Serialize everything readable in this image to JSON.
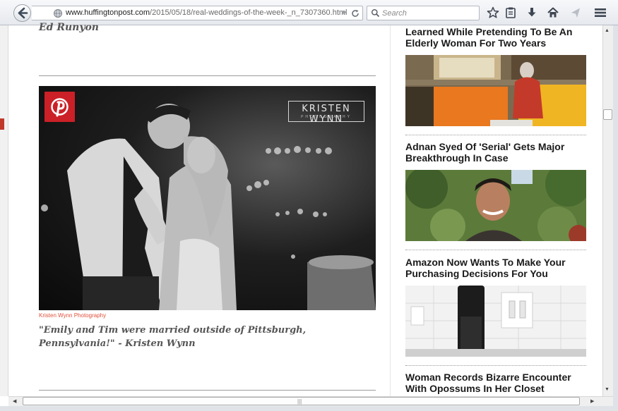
{
  "browser": {
    "url_domain": "www.huffingtonpost.com",
    "url_path": "/2015/05/18/real-weddings-of-the-week-_n_7307360.html",
    "search_placeholder": "Search"
  },
  "article": {
    "author_top": "Ed Runyon",
    "photo_watermark_name": "KRISTEN WYNN",
    "photo_watermark_sub": "PHOTOGRAPHY",
    "photo_credit": "Kristen Wynn Photography",
    "caption": "\"Emily and Tim were married outside of Pittsburgh, Pennsylvania!\" - Kristen Wynn"
  },
  "sidebar": {
    "items": [
      {
        "title": "Learned While Pretending To Be An Elderly Woman For Two Years"
      },
      {
        "title": "Adnan Syed Of 'Serial' Gets Major Breakthrough In Case"
      },
      {
        "title": "Amazon Now Wants To Make Your Purchasing Decisions For You"
      },
      {
        "title": "Woman Records Bizarre Encounter With Opossums In Her Closet"
      }
    ]
  },
  "icons": {
    "back": "back-arrow-icon",
    "identity": "globe-icon",
    "reload": "reload-icon",
    "search": "search-icon",
    "bookmark": "star-icon",
    "reading_list": "clipboard-icon",
    "downloads": "download-icon",
    "home": "home-icon",
    "share": "share-icon",
    "menu": "hamburger-menu-icon",
    "pinterest": "pinterest-icon"
  },
  "colors": {
    "pinterest_red": "#cb2027",
    "credit_orange": "#e0503a"
  }
}
